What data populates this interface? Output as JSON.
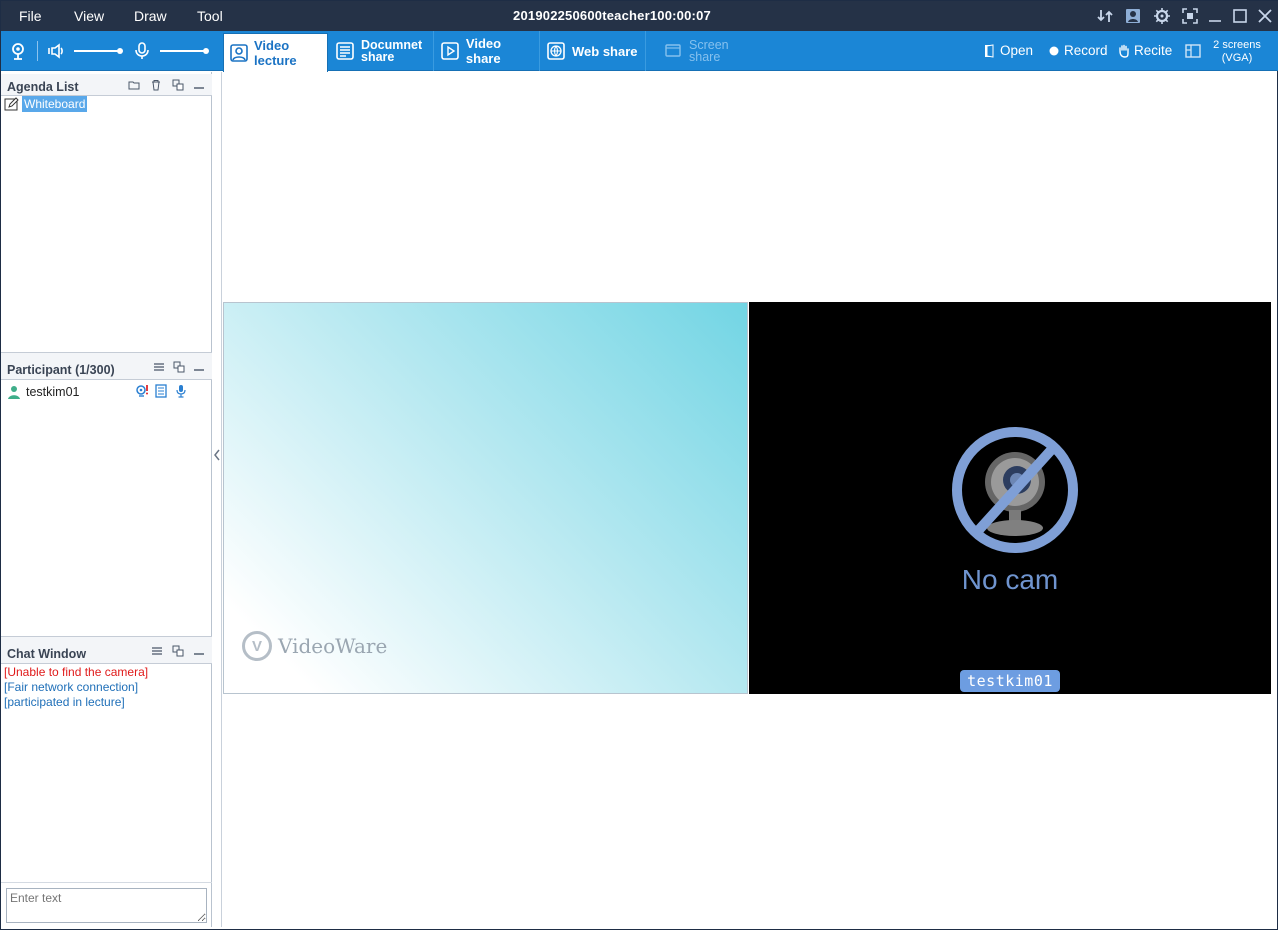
{
  "menu": {
    "file": "File",
    "view": "View",
    "draw": "Draw",
    "tool": "Tool"
  },
  "window": {
    "title": "20190225060 0teacher100:00:07"
  },
  "toolbar": {
    "tabs": {
      "video_lecture": "Video lecture",
      "document_share_line1": "Documnet",
      "document_share_line2": "share",
      "video_share": "Video share",
      "web_share": "Web share",
      "screen_share_line1": "Screen",
      "screen_share_line2": "share"
    },
    "open": "Open",
    "record": "Record",
    "recite": "Recite",
    "screens_line1": "2 screens",
    "screens_line2": "(VGA)"
  },
  "agenda": {
    "title": "Agenda List",
    "items": [
      {
        "label": "Whiteboard"
      }
    ]
  },
  "participants": {
    "title": "Participant (1/300)",
    "items": [
      {
        "name": "testkim01"
      }
    ]
  },
  "chat": {
    "title": "Chat Window",
    "messages": [
      {
        "text": "[Unable to find the camera]",
        "color": "#e01a1a"
      },
      {
        "text": "[Fair network connection]",
        "color": "#1f6fb8"
      },
      {
        "text": "[participated in lecture]",
        "color": "#1f6fb8"
      }
    ],
    "input_placeholder": "Enter text"
  },
  "video": {
    "logo_text": "VideoWare",
    "logo_letter": "V"
  },
  "camera": {
    "no_cam_text": "No cam",
    "user_label": "testkim01"
  },
  "colors": {
    "titlebar": "#253247",
    "toolbar": "#1b86d6",
    "accent": "#1b73c4"
  }
}
